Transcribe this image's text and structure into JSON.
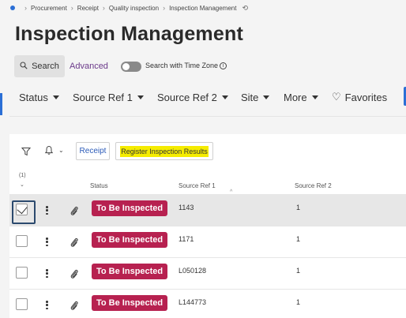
{
  "breadcrumb": [
    "Procurement",
    "Receipt",
    "Quality inspection",
    "Inspection Management"
  ],
  "page_title": "Inspection Management",
  "search": {
    "label": "Search",
    "advanced_label": "Advanced",
    "timezone_label": "Search with Time Zone",
    "timezone_enabled": false
  },
  "filters": [
    {
      "label": "Status"
    },
    {
      "label": "Source Ref 1"
    },
    {
      "label": "Source Ref 2"
    },
    {
      "label": "Site"
    },
    {
      "label": "More"
    }
  ],
  "favorites_label": "Favorites",
  "toolbar": {
    "receipt_label": "Receipt",
    "register_label": "Register Inspection Results",
    "register_highlight": "#f5ec00"
  },
  "table": {
    "selection_count": "(1)",
    "columns": [
      "Status",
      "Source Ref 1",
      "Source Ref 2"
    ],
    "rows": [
      {
        "selected": true,
        "status": "To Be Inspected",
        "source_ref_1": "1143",
        "source_ref_2": "1"
      },
      {
        "selected": false,
        "status": "To Be Inspected",
        "source_ref_1": "1171",
        "source_ref_2": "1"
      },
      {
        "selected": false,
        "status": "To Be Inspected",
        "source_ref_1": "L050128",
        "source_ref_2": "1"
      },
      {
        "selected": false,
        "status": "To Be Inspected",
        "source_ref_1": "L144773",
        "source_ref_2": "1"
      }
    ]
  },
  "colors": {
    "status_badge": "#b72150",
    "accent": "#2b6fd6",
    "advanced_link": "#6b3a8a"
  }
}
